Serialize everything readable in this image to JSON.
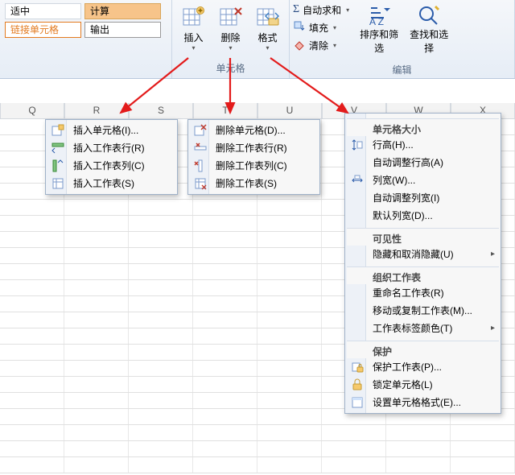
{
  "styles": {
    "left_top": "适中",
    "right_top": "计算",
    "left_bot": "链接单元格",
    "right_bot": "输出"
  },
  "cells_group": {
    "insert": "插入",
    "delete": "删除",
    "format": "格式",
    "label": "单元格"
  },
  "edit_group": {
    "autosum": "自动求和",
    "fill": "填充",
    "clear": "清除",
    "sortfilter": "排序和筛选",
    "findselect": "查找和选择",
    "label": "编辑"
  },
  "colheaders": [
    "Q",
    "R",
    "S",
    "T",
    "U",
    "V",
    "W",
    "X"
  ],
  "menu_insert": [
    "插入单元格(I)...",
    "插入工作表行(R)",
    "插入工作表列(C)",
    "插入工作表(S)"
  ],
  "menu_delete": [
    "删除单元格(D)...",
    "删除工作表行(R)",
    "删除工作表列(C)",
    "删除工作表(S)"
  ],
  "menu_format": {
    "sec_size": "单元格大小",
    "rowheight": "行高(H)...",
    "autorowh": "自动调整行高(A)",
    "colwidth": "列宽(W)...",
    "autocolw": "自动调整列宽(I)",
    "defcolw": "默认列宽(D)...",
    "sec_vis": "可见性",
    "hideunhide": "隐藏和取消隐藏(U)",
    "sec_org": "组织工作表",
    "rename": "重命名工作表(R)",
    "movecopy": "移动或复制工作表(M)...",
    "tabcolor": "工作表标签颜色(T)",
    "sec_prot": "保护",
    "protectsheet": "保护工作表(P)...",
    "lockcell": "锁定单元格(L)",
    "formatcells": "设置单元格格式(E)..."
  }
}
